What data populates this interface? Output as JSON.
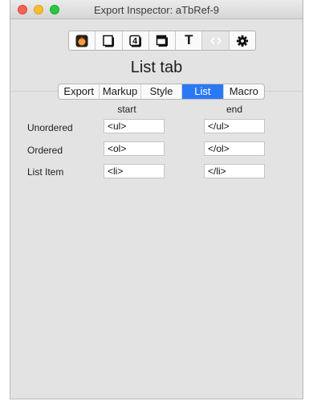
{
  "window": {
    "title": "Export Inspector: aTbRef-9"
  },
  "toolbar": {
    "icons": [
      {
        "name": "app-icon",
        "selected": false
      },
      {
        "name": "document-icon",
        "selected": false
      },
      {
        "name": "badge-4-icon",
        "selected": false
      },
      {
        "name": "window-icon",
        "selected": false
      },
      {
        "name": "text-icon",
        "selected": false
      },
      {
        "name": "code-brackets-icon",
        "selected": true
      },
      {
        "name": "gear-icon",
        "selected": false
      }
    ],
    "badge_number": "4",
    "text_glyph": "T"
  },
  "page_title": "List tab",
  "tabs": [
    {
      "label": "Export",
      "active": false
    },
    {
      "label": "Markup",
      "active": false
    },
    {
      "label": "Style",
      "active": false
    },
    {
      "label": "List",
      "active": true
    },
    {
      "label": "Macro",
      "active": false
    }
  ],
  "columns": {
    "start": "start",
    "end": "end"
  },
  "rows": [
    {
      "label": "Unordered",
      "start": "<ul>",
      "end": "</ul>"
    },
    {
      "label": "Ordered",
      "start": "<ol>",
      "end": "</ol>"
    },
    {
      "label": "List Item",
      "start": "<li>",
      "end": "</li>"
    }
  ],
  "colors": {
    "accent": "#2979f6",
    "window_background": "#e3e3e3"
  }
}
